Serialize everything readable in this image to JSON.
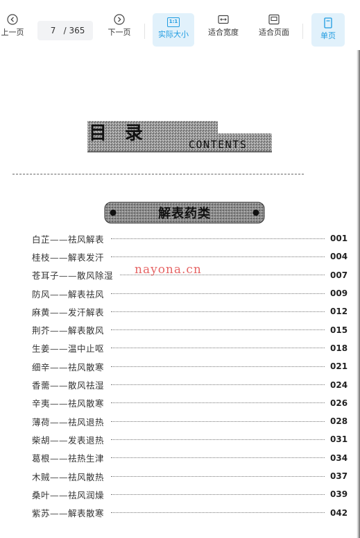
{
  "toolbar": {
    "prev_label": "上一页",
    "page_current": "7",
    "page_total": "/ 365",
    "next_label": "下一页",
    "actual_size_icon_text": "1:1",
    "actual_size_label": "实际大小",
    "fit_width_label": "适合宽度",
    "fit_page_label": "适合页面",
    "single_page_label": "单页",
    "accent_color": "#1e9be0"
  },
  "document": {
    "title_cn": "目　录",
    "title_en": "CONTENTS",
    "section_title": "解表药类",
    "watermark": "nayona.cn",
    "toc": [
      {
        "entry": "白芷——祛风解表",
        "page": "001"
      },
      {
        "entry": "桂枝——解表发汗",
        "page": "004"
      },
      {
        "entry": "苍耳子——散风除湿",
        "page": "007"
      },
      {
        "entry": "防风——解表祛风",
        "page": "009"
      },
      {
        "entry": "麻黄——发汗解表",
        "page": "012"
      },
      {
        "entry": "荆芥——解表散风",
        "page": "015"
      },
      {
        "entry": "生姜——温中止呕",
        "page": "018"
      },
      {
        "entry": "细辛——祛风散寒",
        "page": "021"
      },
      {
        "entry": "香薷——散风祛湿",
        "page": "024"
      },
      {
        "entry": "辛夷——祛风散寒",
        "page": "026"
      },
      {
        "entry": "薄荷——祛风退热",
        "page": "028"
      },
      {
        "entry": "柴胡——发表退热",
        "page": "031"
      },
      {
        "entry": "葛根——祛热生津",
        "page": "034"
      },
      {
        "entry": "木贼——祛风散热",
        "page": "037"
      },
      {
        "entry": "桑叶——祛风润燥",
        "page": "039"
      },
      {
        "entry": "紫苏——解表散寒",
        "page": "042"
      }
    ]
  }
}
